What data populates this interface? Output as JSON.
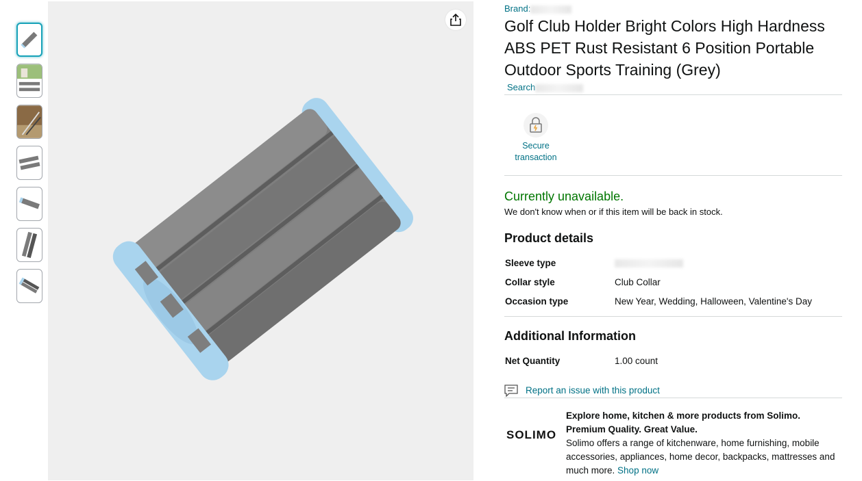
{
  "brand": {
    "label": "Brand:"
  },
  "product": {
    "title": "Golf Club Holder Bright Colors High Hardness ABS PET Rust Resistant 6 Position Portable Outdoor Sports Training (Grey)",
    "search_label": "Search"
  },
  "secure": {
    "line1": "Secure",
    "line2": "transaction"
  },
  "availability": {
    "status": "Currently unavailable.",
    "note": "We don't know when or if this item will be back in stock."
  },
  "product_details": {
    "heading": "Product details",
    "rows": [
      {
        "key": "Sleeve type",
        "value": ""
      },
      {
        "key": "Collar style",
        "value": "Club Collar"
      },
      {
        "key": "Occasion type",
        "value": "New Year, Wedding, Halloween, Valentine's Day"
      }
    ]
  },
  "additional_info": {
    "heading": "Additional Information",
    "rows": [
      {
        "key": "Net Quantity",
        "value": "1.00 count"
      }
    ]
  },
  "report": {
    "label": "Report an issue with this product"
  },
  "solimo": {
    "logo": "SOLIMO",
    "headline1": "Explore home, kitchen & more products from Solimo.",
    "headline2": "Premium Quality. Great Value.",
    "body": "Solimo offers a range of kitchenware, home furnishing, mobile accessories, appliances, home decor, backpacks, mattresses and much more.",
    "shop_now": "Shop now"
  },
  "icons": {
    "share": "share-icon",
    "lock": "lock-icon",
    "report": "report-icon"
  },
  "colors": {
    "link": "#007185",
    "available_green": "#007600",
    "thumb_active": "#17a2b8",
    "product_grey": "#7a7a7a",
    "product_blue": "#a9d4ee"
  }
}
